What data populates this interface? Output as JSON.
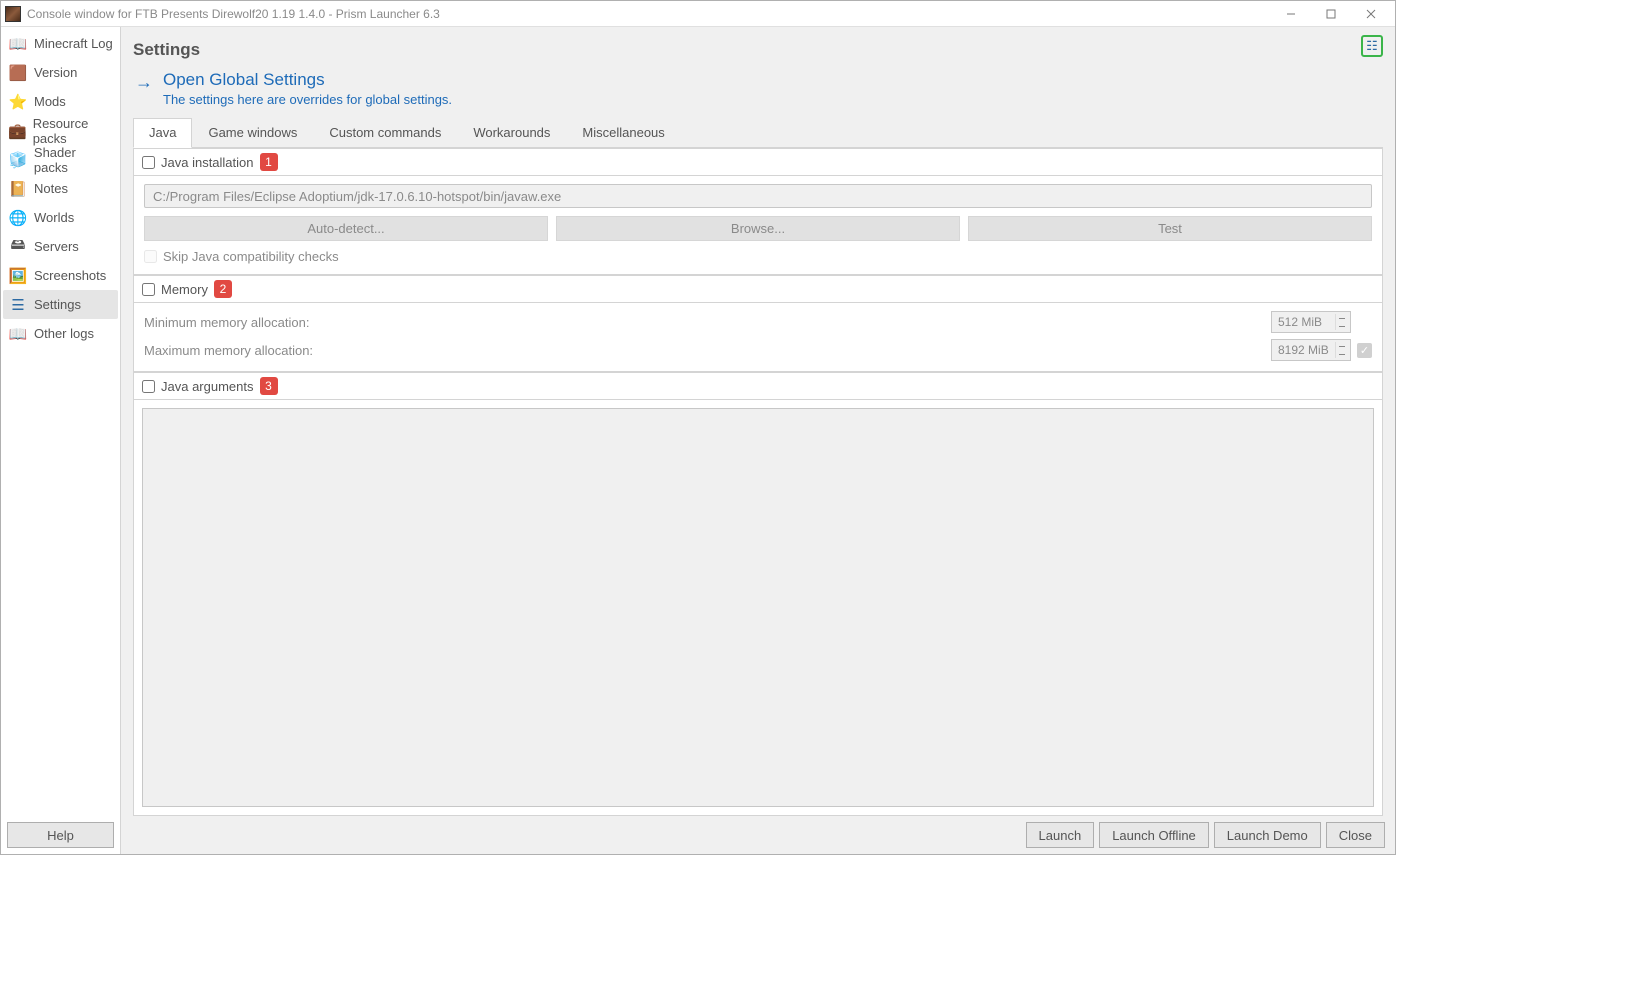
{
  "window": {
    "title": "Console window for FTB Presents Direwolf20 1.19 1.4.0 - Prism Launcher 6.3"
  },
  "sidebar": {
    "items": [
      {
        "label": "Minecraft Log"
      },
      {
        "label": "Version"
      },
      {
        "label": "Mods"
      },
      {
        "label": "Resource packs"
      },
      {
        "label": "Shader packs"
      },
      {
        "label": "Notes"
      },
      {
        "label": "Worlds"
      },
      {
        "label": "Servers"
      },
      {
        "label": "Screenshots"
      },
      {
        "label": "Settings"
      },
      {
        "label": "Other logs"
      }
    ],
    "help": "Help"
  },
  "page": {
    "title": "Settings",
    "global_link": "Open Global Settings",
    "global_sub": "The settings here are overrides for global settings."
  },
  "tabs": [
    {
      "label": "Java"
    },
    {
      "label": "Game windows"
    },
    {
      "label": "Custom commands"
    },
    {
      "label": "Workarounds"
    },
    {
      "label": "Miscellaneous"
    }
  ],
  "java_install": {
    "title": "Java installation",
    "badge": "1",
    "path": "C:/Program Files/Eclipse Adoptium/jdk-17.0.6.10-hotspot/bin/javaw.exe",
    "auto": "Auto-detect...",
    "browse": "Browse...",
    "test": "Test",
    "skip_label": "Skip Java compatibility checks"
  },
  "memory": {
    "title": "Memory",
    "badge": "2",
    "min_label": "Minimum memory allocation:",
    "max_label": "Maximum memory allocation:",
    "min_value": "512 MiB",
    "max_value": "8192 MiB"
  },
  "java_args": {
    "title": "Java arguments",
    "badge": "3"
  },
  "footer": {
    "launch": "Launch",
    "offline": "Launch Offline",
    "demo": "Launch Demo",
    "close": "Close"
  }
}
